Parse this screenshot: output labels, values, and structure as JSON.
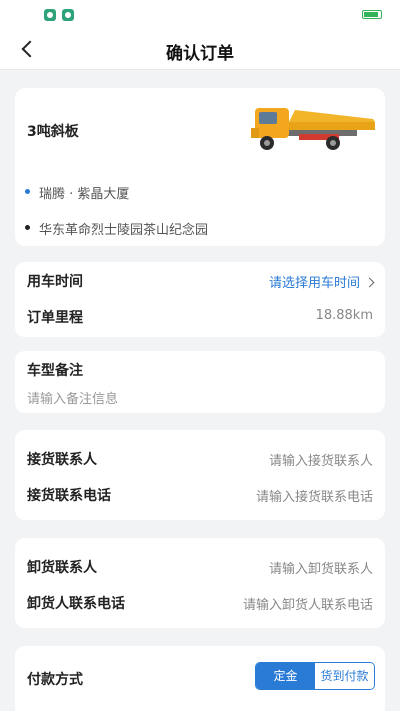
{
  "header": {
    "title": "确认订单"
  },
  "vehicle": {
    "name": "3吨斜板",
    "origin": "瑞腾 · 紫晶大厦",
    "destination": "华东革命烈士陵园茶山纪念园",
    "origin_color": "#2a7bd6",
    "destination_color": "#222222"
  },
  "schedule": {
    "time_label": "用车时间",
    "time_value": "请选择用车时间",
    "distance_label": "订单里程",
    "distance_value": "18.88km"
  },
  "note": {
    "label": "车型备注",
    "placeholder": "请输入备注信息"
  },
  "pickup": {
    "contact_label": "接货联系人",
    "contact_placeholder": "请输入接货联系人",
    "phone_label": "接货联系电话",
    "phone_placeholder": "请输入接货联系电话"
  },
  "unload": {
    "contact_label": "卸货联系人",
    "contact_placeholder": "请输入卸货联系人",
    "phone_label": "卸货人联系电话",
    "phone_placeholder": "请输入卸货人联系电话"
  },
  "payment": {
    "label": "付款方式",
    "options": [
      "定金",
      "货到付款"
    ],
    "selected": "定金"
  },
  "colors": {
    "accent": "#2a7bd6",
    "background": "#f2f3f5"
  }
}
